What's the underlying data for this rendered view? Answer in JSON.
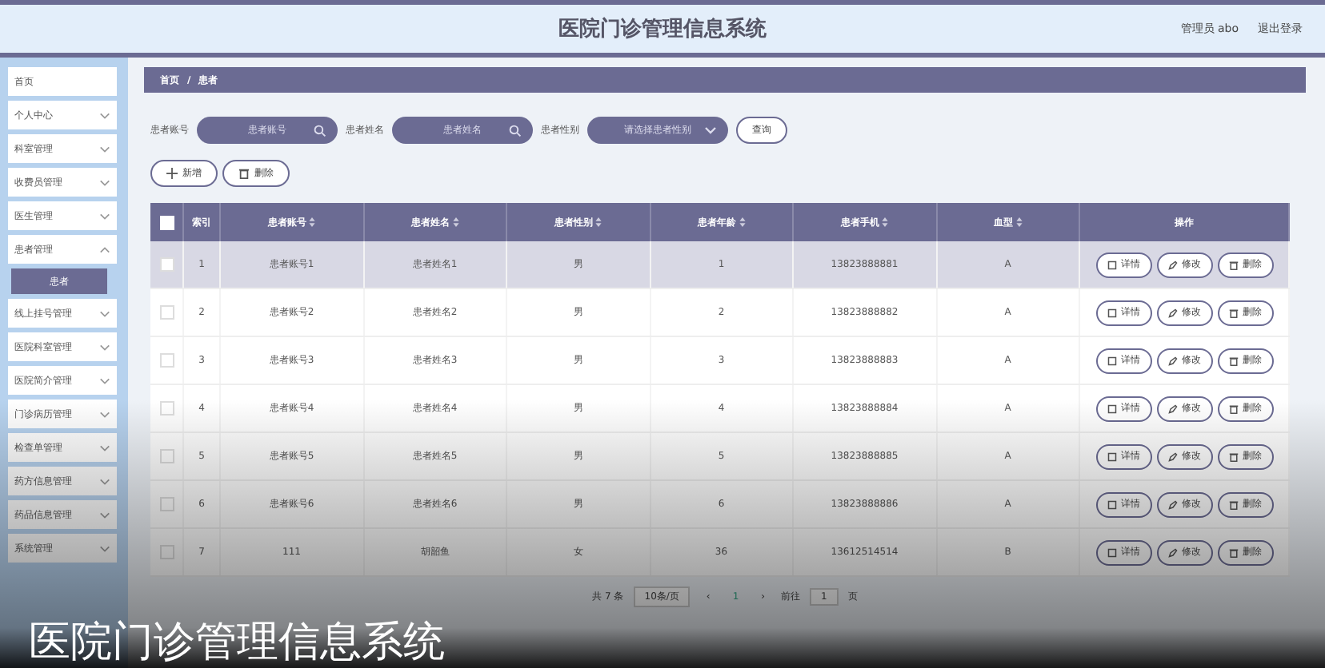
{
  "header": {
    "title": "医院门诊管理信息系统",
    "user": "管理员 abo",
    "logout": "退出登录"
  },
  "sidebar": {
    "items": [
      {
        "label": "首页"
      },
      {
        "label": "个人中心",
        "expanded": false
      },
      {
        "label": "科室管理",
        "expanded": false
      },
      {
        "label": "收费员管理",
        "expanded": false
      },
      {
        "label": "医生管理",
        "expanded": false
      },
      {
        "label": "患者管理",
        "expanded": true,
        "children": [
          {
            "label": "患者",
            "selected": true
          }
        ]
      },
      {
        "label": "线上挂号管理",
        "expanded": false
      },
      {
        "label": "医院科室管理",
        "expanded": false
      },
      {
        "label": "医院简介管理",
        "expanded": false
      },
      {
        "label": "门诊病历管理",
        "expanded": false
      },
      {
        "label": "检查单管理",
        "expanded": false
      },
      {
        "label": "药方信息管理",
        "expanded": false
      },
      {
        "label": "药品信息管理",
        "expanded": false
      },
      {
        "label": "系统管理",
        "expanded": false
      }
    ]
  },
  "breadcrumb": [
    "首页",
    "/",
    "患者"
  ],
  "filters": [
    {
      "kind": "input",
      "label": "患者账号",
      "placeholder": "患者账号"
    },
    {
      "kind": "input",
      "label": "患者姓名",
      "placeholder": "患者姓名"
    },
    {
      "kind": "select",
      "label": "患者性别",
      "placeholder": "请选择患者性别"
    }
  ],
  "search_button": "查询",
  "actions": [
    {
      "kind": "add",
      "label": "新增"
    },
    {
      "kind": "delete",
      "label": "删除"
    }
  ],
  "table": {
    "all_checked": false,
    "columns": [
      {
        "label": "索引",
        "sortable": false
      },
      {
        "label": "患者账号",
        "sortable": true
      },
      {
        "label": "患者姓名",
        "sortable": true
      },
      {
        "label": "患者性别",
        "sortable": true
      },
      {
        "label": "患者年龄",
        "sortable": true
      },
      {
        "label": "患者手机",
        "sortable": true
      },
      {
        "label": "血型",
        "sortable": true
      },
      {
        "label": "操作",
        "sortable": false
      }
    ],
    "rows": [
      {
        "cells": [
          "1",
          "患者账号1",
          "患者姓名1",
          "男",
          "1",
          "13823888881",
          "A"
        ],
        "checked": false,
        "highlighted": true,
        "actions": [
          {
            "kind": "detail",
            "label": "详情"
          },
          {
            "kind": "edit",
            "label": "修改"
          },
          {
            "kind": "delete",
            "label": "删除"
          }
        ]
      },
      {
        "cells": [
          "2",
          "患者账号2",
          "患者姓名2",
          "男",
          "2",
          "13823888882",
          "A"
        ],
        "checked": false,
        "highlighted": false,
        "actions": [
          {
            "kind": "detail",
            "label": "详情"
          },
          {
            "kind": "edit",
            "label": "修改"
          },
          {
            "kind": "delete",
            "label": "删除"
          }
        ]
      },
      {
        "cells": [
          "3",
          "患者账号3",
          "患者姓名3",
          "男",
          "3",
          "13823888883",
          "A"
        ],
        "checked": false,
        "highlighted": false,
        "actions": [
          {
            "kind": "detail",
            "label": "详情"
          },
          {
            "kind": "edit",
            "label": "修改"
          },
          {
            "kind": "delete",
            "label": "删除"
          }
        ]
      },
      {
        "cells": [
          "4",
          "患者账号4",
          "患者姓名4",
          "男",
          "4",
          "13823888884",
          "A"
        ],
        "checked": false,
        "highlighted": false,
        "actions": [
          {
            "kind": "detail",
            "label": "详情"
          },
          {
            "kind": "edit",
            "label": "修改"
          },
          {
            "kind": "delete",
            "label": "删除"
          }
        ]
      },
      {
        "cells": [
          "5",
          "患者账号5",
          "患者姓名5",
          "男",
          "5",
          "13823888885",
          "A"
        ],
        "checked": false,
        "highlighted": false,
        "actions": [
          {
            "kind": "detail",
            "label": "详情"
          },
          {
            "kind": "edit",
            "label": "修改"
          },
          {
            "kind": "delete",
            "label": "删除"
          }
        ]
      },
      {
        "cells": [
          "6",
          "患者账号6",
          "患者姓名6",
          "男",
          "6",
          "13823888886",
          "A"
        ],
        "checked": false,
        "highlighted": false,
        "actions": [
          {
            "kind": "detail",
            "label": "详情"
          },
          {
            "kind": "edit",
            "label": "修改"
          },
          {
            "kind": "delete",
            "label": "删除"
          }
        ]
      },
      {
        "cells": [
          "7",
          "111",
          "胡韶鱼",
          "女",
          "36",
          "13612514514",
          "B"
        ],
        "checked": false,
        "highlighted": false,
        "actions": [
          {
            "kind": "detail",
            "label": "详情"
          },
          {
            "kind": "edit",
            "label": "修改"
          },
          {
            "kind": "delete",
            "label": "删除"
          }
        ]
      }
    ]
  },
  "pagination": {
    "total": "共 7 条",
    "page_size": "10条/页",
    "prev": "‹",
    "page": "1",
    "next": "›",
    "goto_label": "前往",
    "goto_value": "1",
    "goto_suffix": "页"
  },
  "caption": "医院门诊管理信息系统"
}
